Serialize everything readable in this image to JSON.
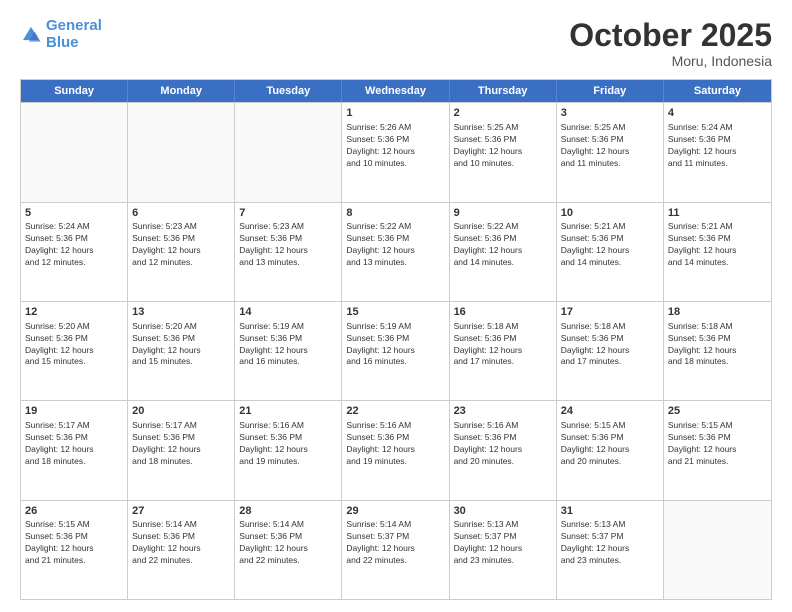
{
  "logo": {
    "line1": "General",
    "line2": "Blue"
  },
  "title": "October 2025",
  "location": "Moru, Indonesia",
  "header_days": [
    "Sunday",
    "Monday",
    "Tuesday",
    "Wednesday",
    "Thursday",
    "Friday",
    "Saturday"
  ],
  "rows": [
    [
      {
        "day": "",
        "info": ""
      },
      {
        "day": "",
        "info": ""
      },
      {
        "day": "",
        "info": ""
      },
      {
        "day": "1",
        "info": "Sunrise: 5:26 AM\nSunset: 5:36 PM\nDaylight: 12 hours\nand 10 minutes."
      },
      {
        "day": "2",
        "info": "Sunrise: 5:25 AM\nSunset: 5:36 PM\nDaylight: 12 hours\nand 10 minutes."
      },
      {
        "day": "3",
        "info": "Sunrise: 5:25 AM\nSunset: 5:36 PM\nDaylight: 12 hours\nand 11 minutes."
      },
      {
        "day": "4",
        "info": "Sunrise: 5:24 AM\nSunset: 5:36 PM\nDaylight: 12 hours\nand 11 minutes."
      }
    ],
    [
      {
        "day": "5",
        "info": "Sunrise: 5:24 AM\nSunset: 5:36 PM\nDaylight: 12 hours\nand 12 minutes."
      },
      {
        "day": "6",
        "info": "Sunrise: 5:23 AM\nSunset: 5:36 PM\nDaylight: 12 hours\nand 12 minutes."
      },
      {
        "day": "7",
        "info": "Sunrise: 5:23 AM\nSunset: 5:36 PM\nDaylight: 12 hours\nand 13 minutes."
      },
      {
        "day": "8",
        "info": "Sunrise: 5:22 AM\nSunset: 5:36 PM\nDaylight: 12 hours\nand 13 minutes."
      },
      {
        "day": "9",
        "info": "Sunrise: 5:22 AM\nSunset: 5:36 PM\nDaylight: 12 hours\nand 14 minutes."
      },
      {
        "day": "10",
        "info": "Sunrise: 5:21 AM\nSunset: 5:36 PM\nDaylight: 12 hours\nand 14 minutes."
      },
      {
        "day": "11",
        "info": "Sunrise: 5:21 AM\nSunset: 5:36 PM\nDaylight: 12 hours\nand 14 minutes."
      }
    ],
    [
      {
        "day": "12",
        "info": "Sunrise: 5:20 AM\nSunset: 5:36 PM\nDaylight: 12 hours\nand 15 minutes."
      },
      {
        "day": "13",
        "info": "Sunrise: 5:20 AM\nSunset: 5:36 PM\nDaylight: 12 hours\nand 15 minutes."
      },
      {
        "day": "14",
        "info": "Sunrise: 5:19 AM\nSunset: 5:36 PM\nDaylight: 12 hours\nand 16 minutes."
      },
      {
        "day": "15",
        "info": "Sunrise: 5:19 AM\nSunset: 5:36 PM\nDaylight: 12 hours\nand 16 minutes."
      },
      {
        "day": "16",
        "info": "Sunrise: 5:18 AM\nSunset: 5:36 PM\nDaylight: 12 hours\nand 17 minutes."
      },
      {
        "day": "17",
        "info": "Sunrise: 5:18 AM\nSunset: 5:36 PM\nDaylight: 12 hours\nand 17 minutes."
      },
      {
        "day": "18",
        "info": "Sunrise: 5:18 AM\nSunset: 5:36 PM\nDaylight: 12 hours\nand 18 minutes."
      }
    ],
    [
      {
        "day": "19",
        "info": "Sunrise: 5:17 AM\nSunset: 5:36 PM\nDaylight: 12 hours\nand 18 minutes."
      },
      {
        "day": "20",
        "info": "Sunrise: 5:17 AM\nSunset: 5:36 PM\nDaylight: 12 hours\nand 18 minutes."
      },
      {
        "day": "21",
        "info": "Sunrise: 5:16 AM\nSunset: 5:36 PM\nDaylight: 12 hours\nand 19 minutes."
      },
      {
        "day": "22",
        "info": "Sunrise: 5:16 AM\nSunset: 5:36 PM\nDaylight: 12 hours\nand 19 minutes."
      },
      {
        "day": "23",
        "info": "Sunrise: 5:16 AM\nSunset: 5:36 PM\nDaylight: 12 hours\nand 20 minutes."
      },
      {
        "day": "24",
        "info": "Sunrise: 5:15 AM\nSunset: 5:36 PM\nDaylight: 12 hours\nand 20 minutes."
      },
      {
        "day": "25",
        "info": "Sunrise: 5:15 AM\nSunset: 5:36 PM\nDaylight: 12 hours\nand 21 minutes."
      }
    ],
    [
      {
        "day": "26",
        "info": "Sunrise: 5:15 AM\nSunset: 5:36 PM\nDaylight: 12 hours\nand 21 minutes."
      },
      {
        "day": "27",
        "info": "Sunrise: 5:14 AM\nSunset: 5:36 PM\nDaylight: 12 hours\nand 22 minutes."
      },
      {
        "day": "28",
        "info": "Sunrise: 5:14 AM\nSunset: 5:36 PM\nDaylight: 12 hours\nand 22 minutes."
      },
      {
        "day": "29",
        "info": "Sunrise: 5:14 AM\nSunset: 5:37 PM\nDaylight: 12 hours\nand 22 minutes."
      },
      {
        "day": "30",
        "info": "Sunrise: 5:13 AM\nSunset: 5:37 PM\nDaylight: 12 hours\nand 23 minutes."
      },
      {
        "day": "31",
        "info": "Sunrise: 5:13 AM\nSunset: 5:37 PM\nDaylight: 12 hours\nand 23 minutes."
      },
      {
        "day": "",
        "info": ""
      }
    ]
  ]
}
